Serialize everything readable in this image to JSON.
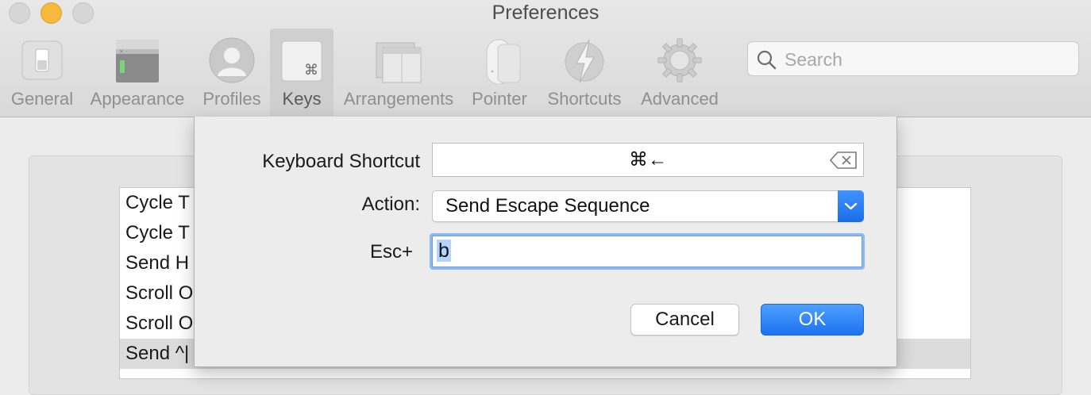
{
  "window": {
    "title": "Preferences"
  },
  "toolbar": {
    "tabs": [
      {
        "label": "General",
        "icon": "general-switch-icon"
      },
      {
        "label": "Appearance",
        "icon": "appearance-window-icon"
      },
      {
        "label": "Profiles",
        "icon": "profile-person-icon"
      },
      {
        "label": "Keys",
        "icon": "command-key-icon",
        "selected": true
      },
      {
        "label": "Arrangements",
        "icon": "arrangements-windows-icon"
      },
      {
        "label": "Pointer",
        "icon": "mouse-pointer-icon"
      },
      {
        "label": "Shortcuts",
        "icon": "lightning-bolt-icon"
      },
      {
        "label": "Advanced",
        "icon": "gear-icon"
      }
    ],
    "search_placeholder": "Search"
  },
  "background_list": {
    "rows": [
      "Cycle T",
      "Cycle T",
      "Send H",
      "Scroll O",
      "Scroll O",
      "Send ^|"
    ]
  },
  "dialog": {
    "shortcut_label": "Keyboard Shortcut",
    "shortcut_value": "⌘←",
    "action_label": "Action:",
    "action_value": "Send Escape Sequence",
    "esc_label": "Esc+",
    "esc_value": "b",
    "cancel_label": "Cancel",
    "ok_label": "OK"
  },
  "colors": {
    "accent": "#1d72f0",
    "selection": "#b3d4fd",
    "minimize": "#f6b93b"
  }
}
